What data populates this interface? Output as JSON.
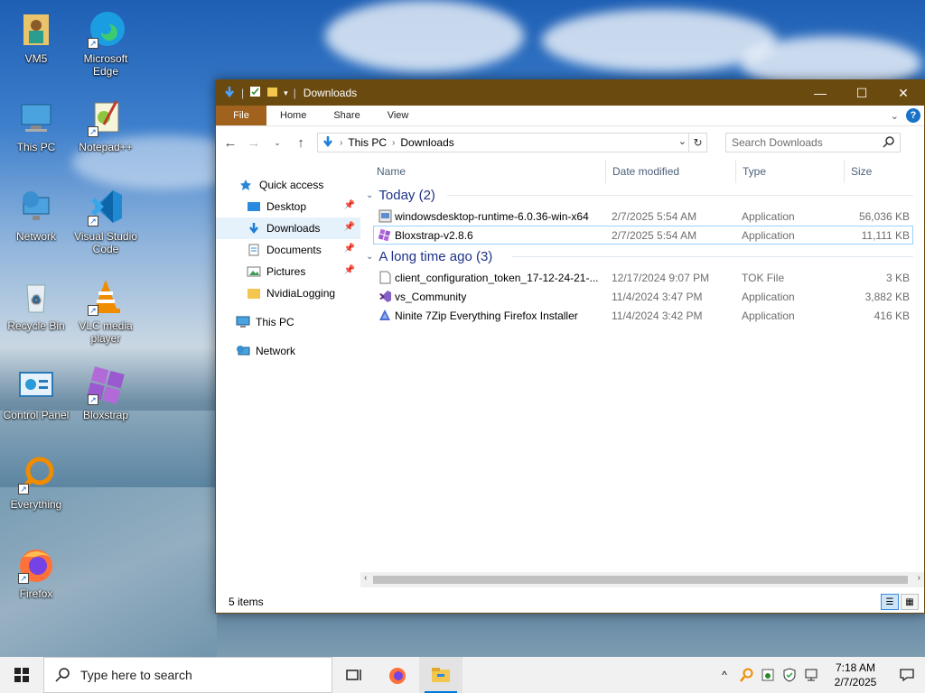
{
  "desktop": {
    "icons": [
      {
        "label": "VM5"
      },
      {
        "label": "Microsoft Edge"
      },
      {
        "label": "This PC"
      },
      {
        "label": "Notepad++"
      },
      {
        "label": "Network"
      },
      {
        "label": "Visual Studio Code"
      },
      {
        "label": "Recycle Bin"
      },
      {
        "label": "VLC media player"
      },
      {
        "label": "Control Panel"
      },
      {
        "label": "Bloxstrap"
      },
      {
        "label": "Everything"
      },
      {
        "label": "Firefox"
      }
    ]
  },
  "window": {
    "title": "Downloads",
    "titlebar_colors": {
      "bar": "#6b4a10",
      "file_tab": "#a0621c"
    },
    "controls": {
      "minimize": "—",
      "maximize": "☐",
      "close": "✕"
    },
    "ribbon_tabs": [
      "File",
      "Home",
      "Share",
      "View"
    ],
    "help": "?",
    "breadcrumb": [
      "This PC",
      "Downloads"
    ],
    "search_placeholder": "Search Downloads",
    "nav": {
      "quick_access": "Quick access",
      "pinned": [
        "Desktop",
        "Downloads",
        "Documents",
        "Pictures"
      ],
      "other": "NvidiaLogging",
      "this_pc": "This PC",
      "network": "Network"
    },
    "columns": {
      "name": "Name",
      "date": "Date modified",
      "type": "Type",
      "size": "Size"
    },
    "groups": [
      {
        "label": "Today (2)",
        "files": [
          {
            "name": "windowsdesktop-runtime-6.0.36-win-x64",
            "date": "2/7/2025 5:54 AM",
            "type": "Application",
            "size": "56,036 KB"
          },
          {
            "name": "Bloxstrap-v2.8.6",
            "date": "2/7/2025 5:54 AM",
            "type": "Application",
            "size": "11,111 KB"
          }
        ]
      },
      {
        "label": "A long time ago (3)",
        "files": [
          {
            "name": "client_configuration_token_17-12-24-21-...",
            "date": "12/17/2024 9:07 PM",
            "type": "TOK File",
            "size": "3 KB"
          },
          {
            "name": "vs_Community",
            "date": "11/4/2024 3:47 PM",
            "type": "Application",
            "size": "3,882 KB"
          },
          {
            "name": "Ninite 7Zip Everything Firefox Installer",
            "date": "11/4/2024 3:42 PM",
            "type": "Application",
            "size": "416 KB"
          }
        ]
      }
    ],
    "status": "5 items"
  },
  "taskbar": {
    "search_placeholder": "Type here to search",
    "time": "7:18 AM",
    "date": "2/7/2025"
  }
}
